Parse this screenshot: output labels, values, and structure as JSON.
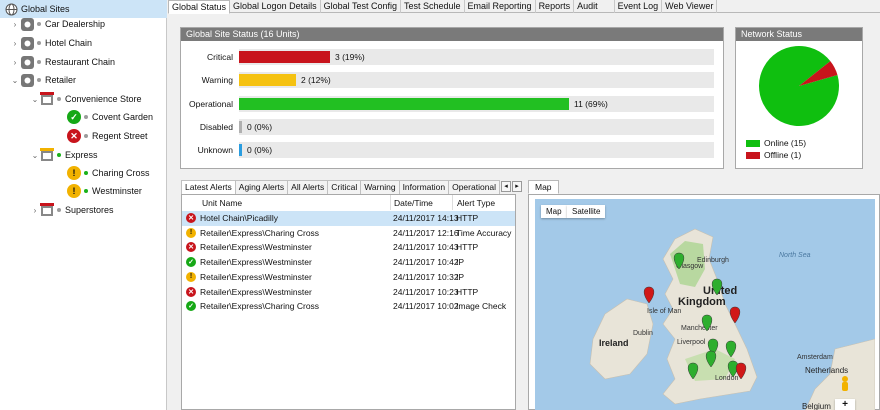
{
  "tree": {
    "root": "Global Sites",
    "groups": [
      {
        "label": "Car Dealership"
      },
      {
        "label": "Hotel Chain"
      },
      {
        "label": "Restaurant Chain"
      },
      {
        "label": "Retailer"
      }
    ],
    "convenience": "Convenience Store",
    "sites_convenience": [
      {
        "label": "Covent Garden",
        "status": "ok"
      },
      {
        "label": "Regent Street",
        "status": "err"
      }
    ],
    "express": "Express",
    "sites_express": [
      {
        "label": "Charing Cross",
        "status": "warn"
      },
      {
        "label": "Westminster",
        "status": "warn"
      }
    ],
    "superstores": "Superstores"
  },
  "tabs": [
    "Global Status",
    "Global Logon Details",
    "Global Test Config",
    "Test Schedule",
    "Email Reporting",
    "Reports",
    "Audit",
    "Event Log",
    "Web Viewer"
  ],
  "site_status": {
    "title": "Global Site Status (16 Units)",
    "rows": [
      {
        "label": "Critical",
        "value_text": "3 (19%)",
        "fraction": 0.19,
        "color": "#c8141c"
      },
      {
        "label": "Warning",
        "value_text": "2 (12%)",
        "fraction": 0.12,
        "color": "#f5c211"
      },
      {
        "label": "Operational",
        "value_text": "11 (69%)",
        "fraction": 0.69,
        "color": "#22c022"
      },
      {
        "label": "Disabled",
        "value_text": "0 (0%)",
        "fraction": 0.0,
        "color": "#b0b0b0"
      },
      {
        "label": "Unknown",
        "value_text": "0 (0%)",
        "fraction": 0.0,
        "color": "#2a9de0"
      }
    ]
  },
  "network": {
    "title": "Network Status",
    "online_label": "Online (15)",
    "offline_label": "Offline (1)",
    "online": 15,
    "offline": 1,
    "online_color": "#0fbf0f",
    "offline_color": "#c8141c"
  },
  "alert_tabs": [
    "Latest Alerts",
    "Aging Alerts",
    "All Alerts",
    "Critical",
    "Warning",
    "Information",
    "Operational"
  ],
  "alerts": {
    "columns": [
      "Unit Name",
      "Date/Time",
      "Alert Type"
    ],
    "rows": [
      {
        "status": "err",
        "unit": "Hotel Chain\\Picadilly",
        "time": "24/11/2017 14:13",
        "type": "HTTP"
      },
      {
        "status": "warn",
        "unit": "Retailer\\Express\\Charing Cross",
        "time": "24/11/2017 12:16",
        "type": "Time Accuracy"
      },
      {
        "status": "err",
        "unit": "Retailer\\Express\\Westminster",
        "time": "24/11/2017 10:43",
        "type": "HTTP"
      },
      {
        "status": "ok",
        "unit": "Retailer\\Express\\Westminster",
        "time": "24/11/2017 10:42",
        "type": "IP"
      },
      {
        "status": "warn",
        "unit": "Retailer\\Express\\Westminster",
        "time": "24/11/2017 10:32",
        "type": "IP"
      },
      {
        "status": "err",
        "unit": "Retailer\\Express\\Westminster",
        "time": "24/11/2017 10:23",
        "type": "HTTP"
      },
      {
        "status": "ok",
        "unit": "Retailer\\Express\\Charing Cross",
        "time": "24/11/2017 10:02",
        "type": "Image Check"
      }
    ]
  },
  "map": {
    "tab": "Map",
    "btn_map": "Map",
    "btn_satellite": "Satellite",
    "labels": {
      "glasgow": "Glasgow",
      "edinburgh": "Edinburgh",
      "uk1": "United",
      "uk2": "Kingdom",
      "isle": "Isle of Man",
      "dublin": "Dublin",
      "ireland": "Ireland",
      "manchester": "Manchester",
      "liverpool": "Liverpool",
      "london": "London",
      "north_sea": "North Sea",
      "netherlands": "Netherlands",
      "amsterdam": "Amsterdam",
      "belgium": "Belgium"
    },
    "zoom_plus": "+"
  }
}
